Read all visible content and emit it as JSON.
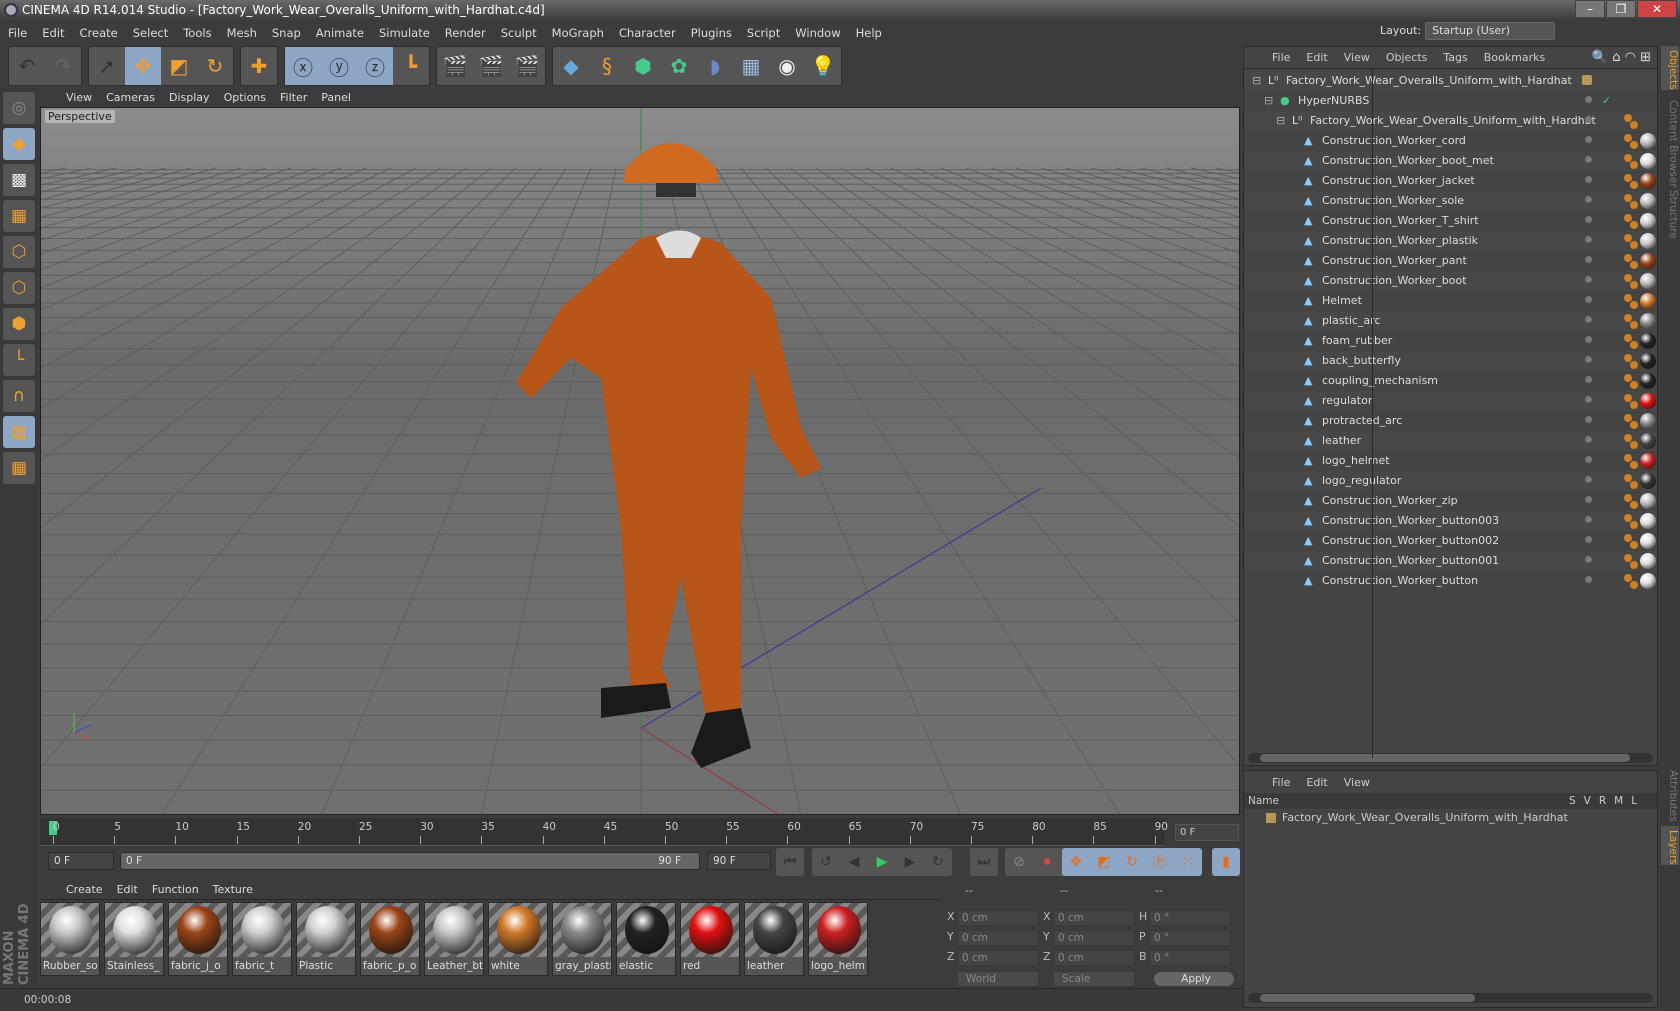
{
  "title": "CINEMA 4D R14.014 Studio - [Factory_Work_Wear_Overalls_Uniform_with_Hardhat.c4d]",
  "menu": [
    "File",
    "Edit",
    "Create",
    "Select",
    "Tools",
    "Mesh",
    "Snap",
    "Animate",
    "Simulate",
    "Render",
    "Sculpt",
    "MoGraph",
    "Character",
    "Plugins",
    "Script",
    "Window",
    "Help"
  ],
  "layout": {
    "label": "Layout:",
    "value": "Startup (User)"
  },
  "toolbar_icons": [
    "undo-icon",
    "redo-icon",
    "select-icon",
    "move-icon",
    "scale-icon",
    "rotate-icon",
    "add-icon",
    "x-axis-icon",
    "y-axis-icon",
    "z-axis-icon",
    "coordinate-system-icon",
    "render-view-icon",
    "render-picture-viewer-icon",
    "render-settings-icon",
    "cube-icon",
    "spline-icon",
    "nurbs-icon",
    "array-icon",
    "deformer-icon",
    "floor-icon",
    "camera-icon",
    "light-icon"
  ],
  "viewport": {
    "menu": [
      "View",
      "Cameras",
      "Display",
      "Options",
      "Filter",
      "Panel"
    ],
    "label": "Perspective"
  },
  "timeline": {
    "ticks": [
      "0",
      "5",
      "10",
      "15",
      "20",
      "25",
      "30",
      "35",
      "40",
      "45",
      "50",
      "55",
      "60",
      "65",
      "70",
      "75",
      "80",
      "85",
      "90"
    ],
    "current_frame": "0 F"
  },
  "controls": {
    "start": "0 F",
    "range_start": "0 F",
    "range_end": "90 F",
    "end": "90 F"
  },
  "materials": {
    "menu": [
      "Create",
      "Edit",
      "Function",
      "Texture"
    ],
    "items": [
      {
        "name": "Rubber_so",
        "color": "#c8c8c8"
      },
      {
        "name": "Stainless_",
        "color": "#e0e0e0"
      },
      {
        "name": "fabric_j_o",
        "color": "#9a4418"
      },
      {
        "name": "fabric_t",
        "color": "#cfcfcf"
      },
      {
        "name": "Plastic",
        "color": "#d0d0d0"
      },
      {
        "name": "fabric_p_o",
        "color": "#9a4418"
      },
      {
        "name": "Leather_bt",
        "color": "#c8c8c8"
      },
      {
        "name": "white",
        "color": "#d07828"
      },
      {
        "name": "gray_plasti",
        "color": "#8a8a8a"
      },
      {
        "name": "elastic",
        "color": "#222222"
      },
      {
        "name": "red",
        "color": "#e01010"
      },
      {
        "name": "leather",
        "color": "#444444"
      },
      {
        "name": "logo_helm",
        "color": "#cc2020"
      }
    ]
  },
  "coords": {
    "headers": [
      "--",
      "--",
      "--"
    ],
    "rows": [
      {
        "l1": "X",
        "v1": "0 cm",
        "l2": "X",
        "v2": "0 cm",
        "l3": "H",
        "v3": "0 °"
      },
      {
        "l1": "Y",
        "v1": "0 cm",
        "l2": "Y",
        "v2": "0 cm",
        "l3": "P",
        "v3": "0 °"
      },
      {
        "l1": "Z",
        "v1": "0 cm",
        "l2": "Z",
        "v2": "0 cm",
        "l3": "B",
        "v3": "0 °"
      }
    ],
    "world": "World",
    "scale": "Scale",
    "apply": "Apply"
  },
  "status": "00:00:08",
  "objects": {
    "menu": [
      "File",
      "Edit",
      "View",
      "Objects",
      "Tags",
      "Bookmarks"
    ],
    "items": [
      {
        "name": "Factory_Work_Wear_Overalls_Uniform_with_Hardhat",
        "level": 0,
        "type": "null"
      },
      {
        "name": "HyperNURBS",
        "level": 1,
        "type": "nurbs"
      },
      {
        "name": "Factory_Work_Wear_Overalls_Uniform_with_Hardhat",
        "level": 2,
        "type": "null"
      },
      {
        "name": "Construction_Worker_cord",
        "level": 3,
        "mat": "#bbbbbb"
      },
      {
        "name": "Construction_Worker_boot_met",
        "level": 3,
        "mat": "#dddddd"
      },
      {
        "name": "Construction_Worker_jacket",
        "level": 3,
        "mat": "#9a4418"
      },
      {
        "name": "Construction_Worker_sole",
        "level": 3,
        "mat": "#bbbbbb"
      },
      {
        "name": "Construction_Worker_T_shirt",
        "level": 3,
        "mat": "#cccccc"
      },
      {
        "name": "Construction_Worker_plastik",
        "level": 3,
        "mat": "#cccccc"
      },
      {
        "name": "Construction_Worker_pant",
        "level": 3,
        "mat": "#9a4418"
      },
      {
        "name": "Construction_Worker_boot",
        "level": 3,
        "mat": "#bbbbbb"
      },
      {
        "name": "Helmet",
        "level": 3,
        "mat": "#d07828"
      },
      {
        "name": "plastic_arc",
        "level": 3,
        "mat": "#8a8a8a"
      },
      {
        "name": "foam_rubber",
        "level": 3,
        "mat": "#222222"
      },
      {
        "name": "back_butterfly",
        "level": 3,
        "mat": "#222222"
      },
      {
        "name": "coupling_mechanism",
        "level": 3,
        "mat": "#222222"
      },
      {
        "name": "regulator",
        "level": 3,
        "mat": "#e01010"
      },
      {
        "name": "protracted_arc",
        "level": 3,
        "mat": "#8a8a8a"
      },
      {
        "name": "leather",
        "level": 3,
        "mat": "#444444"
      },
      {
        "name": "logo_helmet",
        "level": 3,
        "mat": "#cc2020"
      },
      {
        "name": "logo_regulator",
        "level": 3,
        "mat": "#333333"
      },
      {
        "name": "Construction_Worker_zip",
        "level": 3,
        "mat": "#bbbbbb"
      },
      {
        "name": "Construction_Worker_button003",
        "level": 3,
        "mat": "#dddddd"
      },
      {
        "name": "Construction_Worker_button002",
        "level": 3,
        "mat": "#dddddd"
      },
      {
        "name": "Construction_Worker_button001",
        "level": 3,
        "mat": "#dddddd"
      },
      {
        "name": "Construction_Worker_button",
        "level": 3,
        "mat": "#dddddd"
      }
    ]
  },
  "layers": {
    "menu": [
      "File",
      "Edit",
      "View"
    ],
    "col_name": "Name",
    "cols": [
      "S",
      "V",
      "R",
      "M",
      "L"
    ],
    "item": "Factory_Work_Wear_Overalls_Uniform_with_Hardhat"
  },
  "side_tabs": [
    "Objects",
    "Content Browser",
    "Structure",
    "Attributes",
    "Layers"
  ],
  "colors": {
    "accent": "#f0a030",
    "selected_tool": "#8da6c6",
    "layer_color": "#b89858"
  }
}
